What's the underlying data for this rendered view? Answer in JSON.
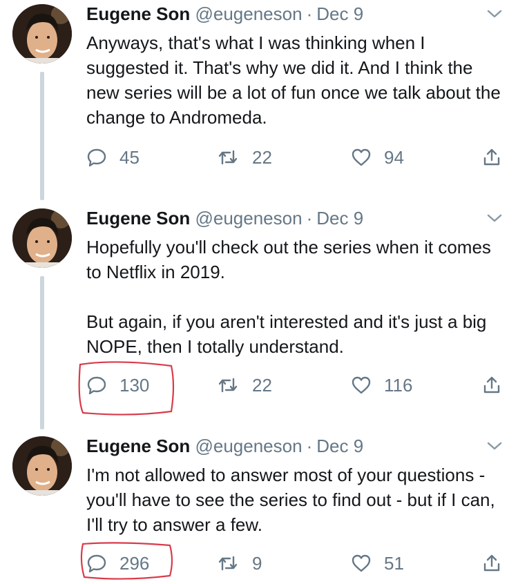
{
  "colors": {
    "annotation": "#d93a4a",
    "muted": "#657786",
    "thread_line": "#ccd6dd"
  },
  "tweets": [
    {
      "name": "Eugene Son",
      "handle": "@eugeneson",
      "separator": "·",
      "date": "Dec 9",
      "text": "Anyways, that's what I was thinking when I suggested it. That's why we did it. And I think the new series will be a lot of fun once we talk about the change to Andromeda.",
      "replies": "45",
      "retweets": "22",
      "likes": "94"
    },
    {
      "name": "Eugene Son",
      "handle": "@eugeneson",
      "separator": "·",
      "date": "Dec 9",
      "text": "Hopefully you'll check out the series when it comes to Netflix in 2019.\n\nBut again, if you aren't interested and it's just a big NOPE, then I totally understand.",
      "replies": "130",
      "retweets": "22",
      "likes": "116"
    },
    {
      "name": "Eugene Son",
      "handle": "@eugeneson",
      "separator": "·",
      "date": "Dec 9",
      "text": "I'm not allowed to answer most of your questions - you'll have to see the series to find out - but if I can, I'll try to answer a few.",
      "replies": "296",
      "retweets": "9",
      "likes": "51"
    }
  ]
}
